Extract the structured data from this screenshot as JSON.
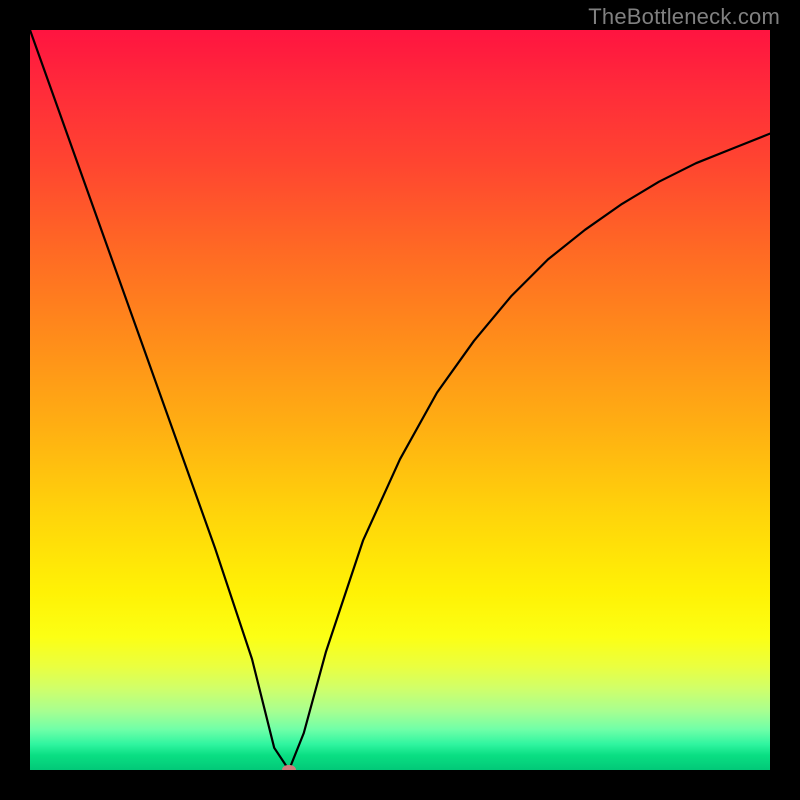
{
  "watermark": "TheBottleneck.com",
  "colors": {
    "background": "#000000",
    "watermark_text": "#808080",
    "curve_stroke": "#000000",
    "marker_fill": "#cf7b7b"
  },
  "chart_data": {
    "type": "line",
    "title": "",
    "xlabel": "",
    "ylabel": "",
    "xlim": [
      0,
      100
    ],
    "ylim": [
      0,
      100
    ],
    "grid": false,
    "legend": false,
    "series": [
      {
        "name": "bottleneck-curve",
        "x": [
          0,
          5,
          10,
          15,
          20,
          25,
          30,
          33,
          35,
          37,
          40,
          45,
          50,
          55,
          60,
          65,
          70,
          75,
          80,
          85,
          90,
          95,
          100
        ],
        "y": [
          100,
          86,
          72,
          58,
          44,
          30,
          15,
          3,
          0,
          5,
          16,
          31,
          42,
          51,
          58,
          64,
          69,
          73,
          76.5,
          79.5,
          82,
          84,
          86
        ]
      }
    ],
    "minimum_marker": {
      "x": 35,
      "y": 0
    }
  }
}
